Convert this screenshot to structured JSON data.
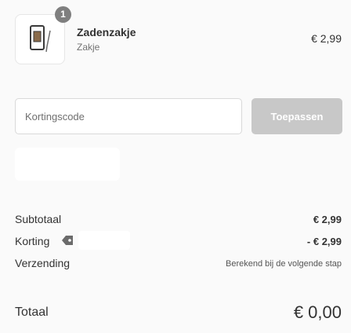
{
  "product": {
    "name": "Zadenzakje",
    "variant": "Zakje",
    "price": "€ 2,99",
    "quantity": "1",
    "thumbnail_icon": "seed-packet-icon"
  },
  "discount": {
    "placeholder": "Kortingscode",
    "apply_label": "Toepassen"
  },
  "totals": {
    "subtotal_label": "Subtotaal",
    "subtotal_value": "€ 2,99",
    "discount_label": "Korting",
    "discount_icon": "tag-icon",
    "discount_value": "- € 2,99",
    "shipping_label": "Verzending",
    "shipping_value": "Berekend bij de volgende stap",
    "total_label": "Totaal",
    "total_value": "€ 0,00"
  },
  "colors": {
    "background": "#fafafa",
    "badge": "#7f7f7f",
    "button_disabled": "#c8c8c8",
    "text": "#333333"
  }
}
